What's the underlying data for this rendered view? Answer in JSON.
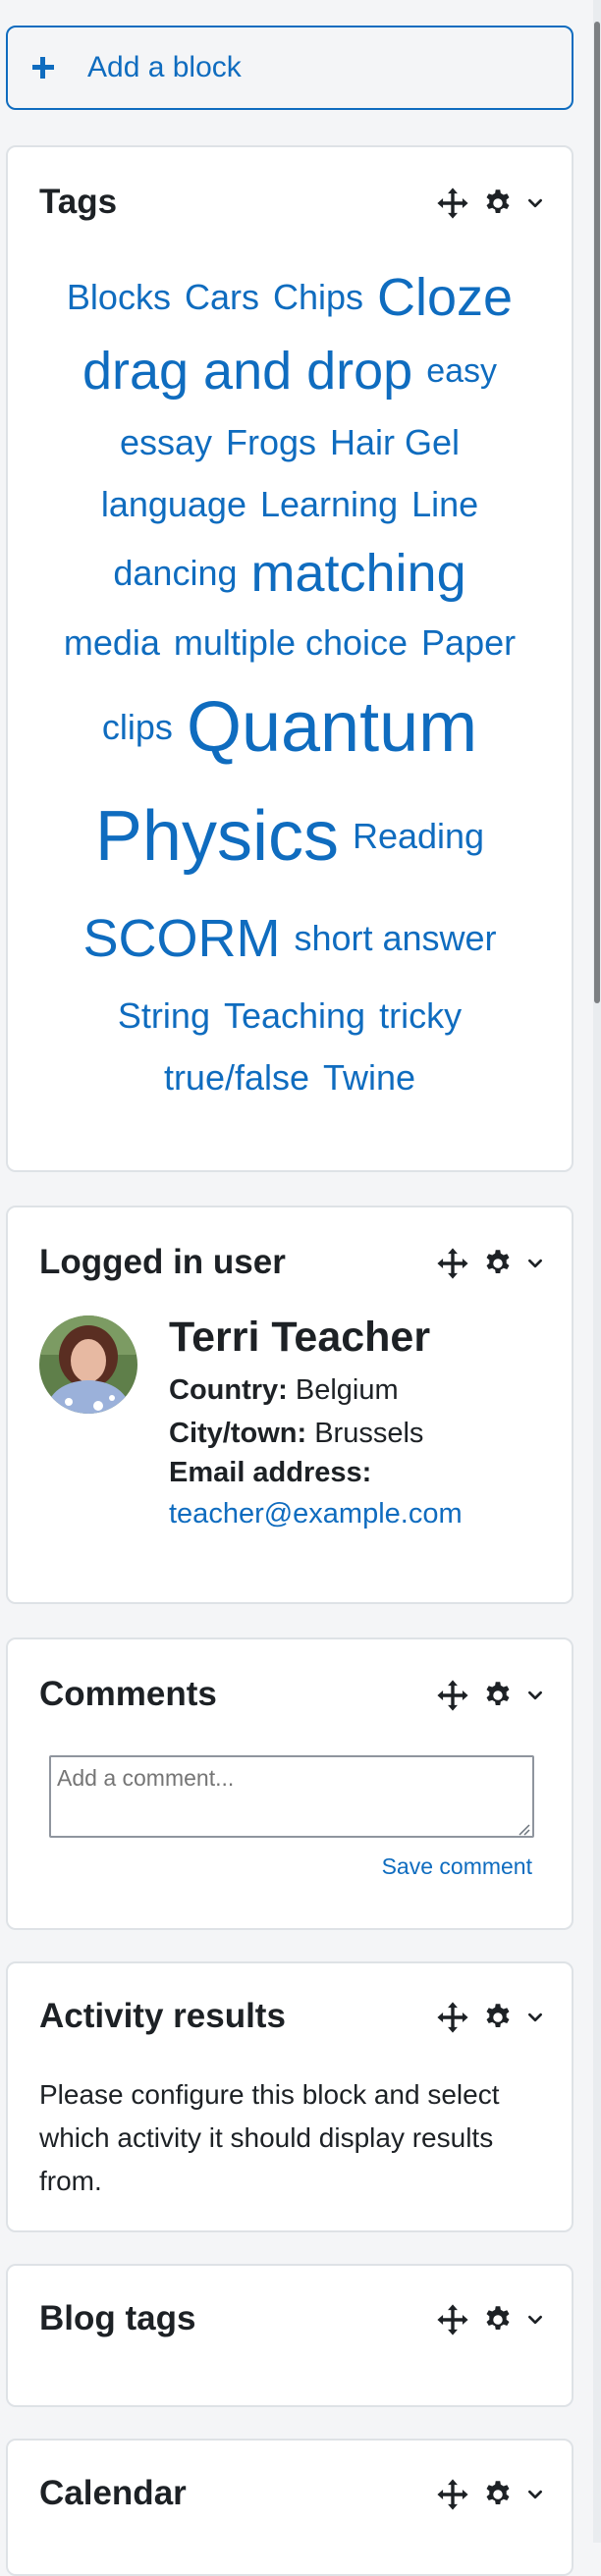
{
  "add_block": {
    "label": "Add a block",
    "icon": "plus-icon"
  },
  "colors": {
    "link": "#0f6cbf",
    "text": "#1d2125",
    "border": "#dee2e6",
    "background": "#f4f5f7"
  },
  "controls": {
    "move_icon": "move-icon",
    "settings_icon": "gear-icon",
    "collapse_icon": "chevron-down-icon"
  },
  "tags_block": {
    "title": "Tags",
    "lines": [
      [
        {
          "text": "Blocks",
          "size": 36
        },
        {
          "text": "Cars",
          "size": 36
        },
        {
          "text": "Chips",
          "size": 36
        },
        {
          "text": "Cloze",
          "size": 54
        }
      ],
      [
        {
          "text": "drag and drop",
          "size": 54
        },
        {
          "text": "easy",
          "size": 34
        }
      ],
      [
        {
          "text": "essay",
          "size": 36
        },
        {
          "text": "Frogs",
          "size": 36
        },
        {
          "text": "Hair Gel",
          "size": 36
        }
      ],
      [
        {
          "text": "language",
          "size": 36
        },
        {
          "text": "Learning",
          "size": 36
        },
        {
          "text": "Line",
          "size": 36
        }
      ],
      [
        {
          "text": "dancing",
          "size": 36
        },
        {
          "text": "matching",
          "size": 54
        }
      ],
      [
        {
          "text": "media",
          "size": 36
        },
        {
          "text": "multiple choice",
          "size": 36
        },
        {
          "text": "Paper",
          "size": 36
        }
      ],
      [
        {
          "text": "clips",
          "size": 36
        },
        {
          "text": "Quantum",
          "size": 72
        }
      ],
      [
        {
          "text": "Physics",
          "size": 72
        },
        {
          "text": "Reading",
          "size": 36
        }
      ],
      [
        {
          "text": "SCORM",
          "size": 54
        },
        {
          "text": "short answer",
          "size": 36
        }
      ],
      [
        {
          "text": "String",
          "size": 36
        },
        {
          "text": "Teaching",
          "size": 36
        },
        {
          "text": "tricky",
          "size": 36
        }
      ],
      [
        {
          "text": "true/false",
          "size": 36
        },
        {
          "text": "Twine",
          "size": 36
        }
      ]
    ]
  },
  "user_block": {
    "title": "Logged in user",
    "name": "Terri Teacher",
    "country_label": "Country:",
    "country": "Belgium",
    "city_label": "City/town:",
    "city": "Brussels",
    "email_label": "Email address:",
    "email": "teacher@example.com"
  },
  "comments_block": {
    "title": "Comments",
    "placeholder": "Add a comment...",
    "save_label": "Save comment"
  },
  "activity_block": {
    "title": "Activity results",
    "text": "Please configure this block and select which activity it should display results from."
  },
  "blog_tags_block": {
    "title": "Blog tags"
  },
  "calendar_block": {
    "title": "Calendar"
  }
}
